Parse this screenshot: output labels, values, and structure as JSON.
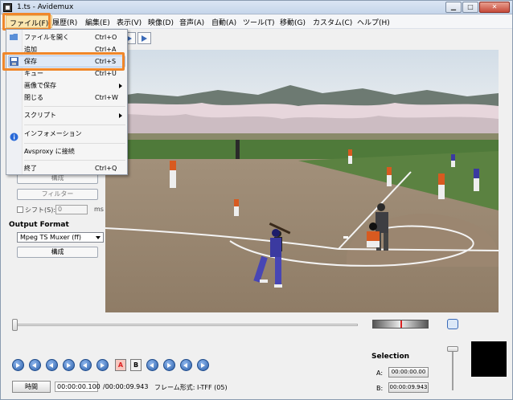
{
  "window": {
    "title": "1.ts - Avidemux"
  },
  "menubar": {
    "items": [
      "ファイル(F)",
      "履歴(R)",
      "編集(E)",
      "表示(V)",
      "映像(D)",
      "音声(A)",
      "自動(A)",
      "ツール(T)",
      "移動(G)",
      "カスタム(C)",
      "ヘルプ(H)"
    ]
  },
  "file_menu": {
    "items": [
      {
        "label": "ファイルを開く",
        "shortcut": "Ctrl+O"
      },
      {
        "label": "追加",
        "shortcut": "Ctrl+A"
      },
      {
        "label": "保存",
        "shortcut": "Ctrl+S"
      },
      {
        "label": "キュー",
        "shortcut": "Ctrl+U"
      },
      {
        "label": "画像で保存",
        "shortcut": ""
      },
      {
        "label": "閉じる",
        "shortcut": "Ctrl+W"
      },
      {
        "label": "スクリプト",
        "shortcut": ""
      },
      {
        "label": "インフォメーション",
        "shortcut": ""
      },
      {
        "label": "Avsproxy に接続",
        "shortcut": ""
      },
      {
        "label": "終了",
        "shortcut": "Ctrl+Q"
      }
    ]
  },
  "left_panel": {
    "configure_label": "構成",
    "filters_label": "フィルター",
    "shift_label": "シフト(S):",
    "shift_value": "0",
    "shift_unit": "ms",
    "output_format_title": "Output Format",
    "output_format_value": "Mpeg TS Muxer (ff)",
    "output_configure_label": "構成"
  },
  "bottom": {
    "marker_a": "A",
    "marker_b": "B",
    "time_button": "時間",
    "current_time": "00:00:00.100",
    "total_time": "/00:00:09.943",
    "frame_type": "フレーム形式: I-TFF (05)",
    "selection_title": "Selection",
    "selection_a_label": "A:",
    "selection_a_value": "00:00:00.00",
    "selection_b_label": "B:",
    "selection_b_value": "00:00:09.943"
  },
  "colors": {
    "highlight": "#f0872a",
    "accent": "#2a5ea8"
  }
}
